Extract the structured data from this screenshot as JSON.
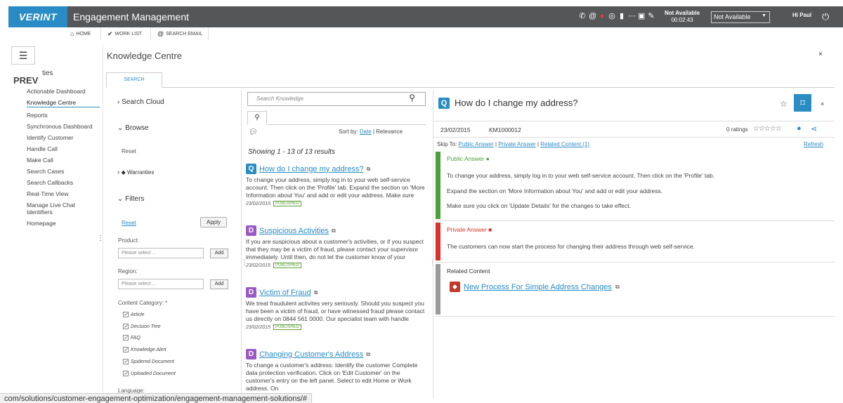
{
  "topbar": {
    "logo": "VERINT",
    "title": "Engagement Management",
    "icons": [
      "phone-icon",
      "at-icon",
      "chat-icon",
      "record-icon",
      "document-icon",
      "network-icon",
      "window-icon",
      "tools-icon"
    ],
    "status_label": "Not Available",
    "status_timer": "00:02:43",
    "status_select": "Not Available",
    "greeting": "Hi Paul"
  },
  "nav": {
    "home": "HOME",
    "worklist": "WORK LIST",
    "search_email": "SEARCH EMAIL"
  },
  "sidebar": {
    "prev": "PREV",
    "partial": "ties",
    "items": [
      "Actionable Dashboard",
      "Knowledge Centre",
      "Reports",
      "Synchronous Dashboard",
      "Identify Customer",
      "Handle Call",
      "Make Call",
      "Search Cases",
      "Search Callbacks",
      "Real-Time View",
      "Manage Live Chat Identifiers",
      "Homepage"
    ]
  },
  "main": {
    "title": "Knowledge Centre",
    "tab_search": "SEARCH"
  },
  "filters": {
    "search_cloud": "Search Cloud",
    "browse": "Browse",
    "reset": "Reset",
    "warranties": "Warranties",
    "filters_label": "Filters",
    "reset2": "Reset",
    "apply": "Apply",
    "product_label": "Product:",
    "product_placeholder": "Please select ...",
    "add": "Add",
    "region_label": "Region:",
    "region_placeholder": "Please select ...",
    "content_category": "Content Category: *",
    "categories": [
      "Article",
      "Decision Tree",
      "FAQ",
      "Knowledge Alert",
      "Spidered Document",
      "Uploaded Document"
    ],
    "language": "Language:"
  },
  "results": {
    "search_placeholder": "Search Knowledge",
    "sort_by": "Sort by:",
    "sort_date": "Date",
    "sort_sep": "|",
    "sort_relevance": "Relevance",
    "showing": "Showing 1 - 13 of 13 results",
    "items": [
      {
        "badge": "Q",
        "title": "How do I change my address?",
        "body": "To change your address, simply log in to your web self-service account. Then click on the 'Profile' tab. Expand the section on 'More Information about You' and add or edit your address. Make sure",
        "date": "23/02/2015",
        "status": "PUBLISHED"
      },
      {
        "badge": "D",
        "title": "Suspicious Activities",
        "body": "If you are suspicious about a customer's activities, or if you suspect that they may be a victim of fraud, please contact your supervisor immediately. Until then, do not let the customer know of your",
        "date": "23/02/2015",
        "status": "PUBLISHED"
      },
      {
        "badge": "D",
        "title": "Victim of Fraud",
        "body": "We treat fraudulent activites very seriously. Should you suspect you have been a victim of fraud, or have witnessed fraud please contact us directly on 0844 561 0000. Our specialist team with handle",
        "date": "23/02/2015",
        "status": "PUBLISHED"
      },
      {
        "badge": "D",
        "title": "Changing Customer's Address",
        "body": "To change a customer's address: Identify the customer Complete data protection verification. Click on 'Edit Customer' on the customer's entry on the left panel. Select to edit Home or Work address. On",
        "date": "",
        "status": ""
      }
    ]
  },
  "article": {
    "badge": "Q",
    "title": "How do I change my address?",
    "date": "23/02/2015",
    "id": "KM1000012",
    "ratings": "0 ratings",
    "stars": "☆☆☆☆☆",
    "skip_to": "Skip To:",
    "skip_public": "Public Answer",
    "skip_private": "Private Answer",
    "skip_related": "Related Content (1)",
    "refresh": "Refresh",
    "public_label": "Public Answer",
    "public_lines": [
      "To change your address, simply log in to your web self-service account. Then click on the 'Profile' tab.",
      "Expand the section on 'More Information about You' and add or edit your address.",
      "Make sure you click on 'Update Details' for the changes to take effect."
    ],
    "private_label": "Private Answer",
    "private_text": "The customers can now start the process for changing their address through web self-service.",
    "related_label": "Related Content",
    "related_link": "New Process For Simple Address Changes"
  },
  "urlbar": {
    "text": "com/solutions/customer-engagement-optimization/engagement-management-solutions/#"
  },
  "colors": {
    "brand_blue": "#2a8cc4",
    "topbar": "#555658",
    "public_green": "#4aa13a",
    "private_red": "#d9312d",
    "related_grey": "#9a9a9a",
    "published_green": "#5a9e3a"
  }
}
